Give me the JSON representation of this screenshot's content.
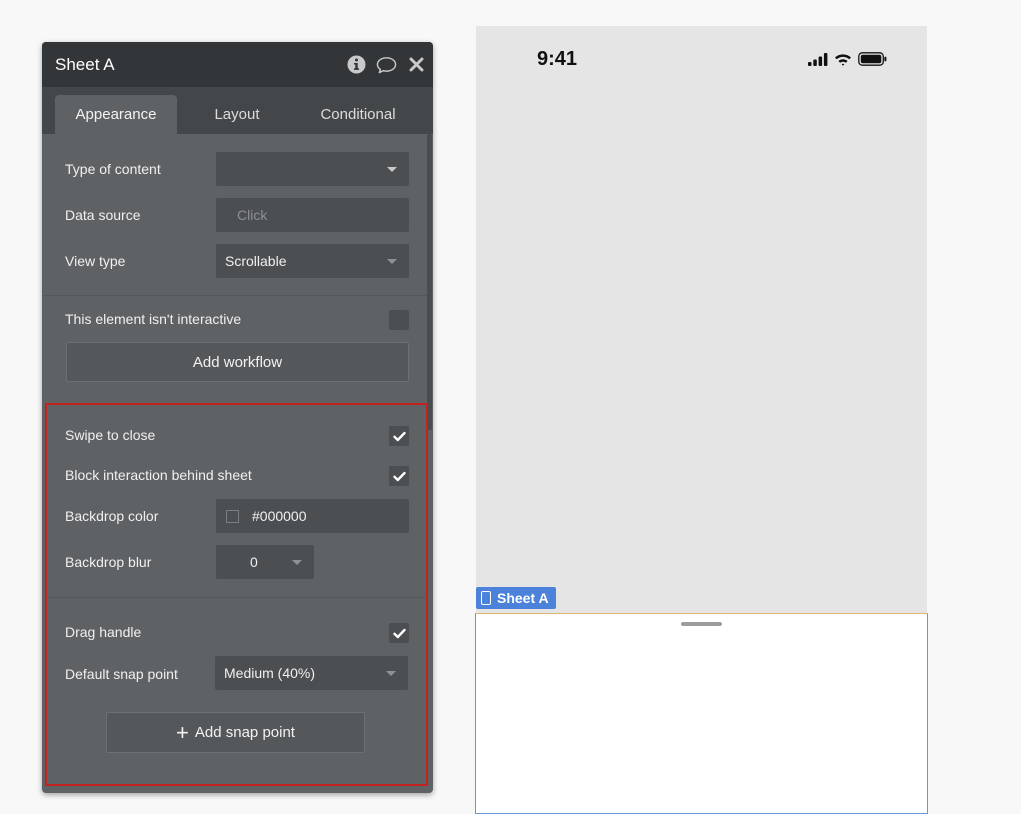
{
  "panel": {
    "title": "Sheet A",
    "tabs": [
      "Appearance",
      "Layout",
      "Conditional"
    ],
    "active_tab": "Appearance"
  },
  "fields": {
    "type_of_content_label": "Type of content",
    "type_of_content_value": "",
    "data_source_label": "Data source",
    "data_source_placeholder": "Click",
    "view_type_label": "View type",
    "view_type_value": "Scrollable",
    "not_interactive_label": "This element isn't interactive",
    "add_workflow_label": "Add workflow",
    "swipe_to_close_label": "Swipe to close",
    "block_interaction_label": "Block interaction behind sheet",
    "backdrop_color_label": "Backdrop color",
    "backdrop_color_value": "#000000",
    "backdrop_blur_label": "Backdrop blur",
    "backdrop_blur_value": "0",
    "drag_handle_label": "Drag handle",
    "default_snap_label": "Default snap point",
    "default_snap_value": "Medium (40%)",
    "add_snap_point_label": "Add snap point"
  },
  "checkboxes": {
    "not_interactive": false,
    "swipe_to_close": true,
    "block_interaction": true,
    "drag_handle": true
  },
  "preview": {
    "status_time": "9:41",
    "sheet_tag_label": "Sheet A"
  },
  "colors": {
    "highlight_border": "#c3231f",
    "tag_blue": "#4c82d9"
  },
  "icons": [
    "info-icon",
    "comment-icon",
    "close-icon",
    "checkmark-icon",
    "plus-icon",
    "signal-icon",
    "wifi-icon",
    "battery-icon",
    "document-icon"
  ]
}
